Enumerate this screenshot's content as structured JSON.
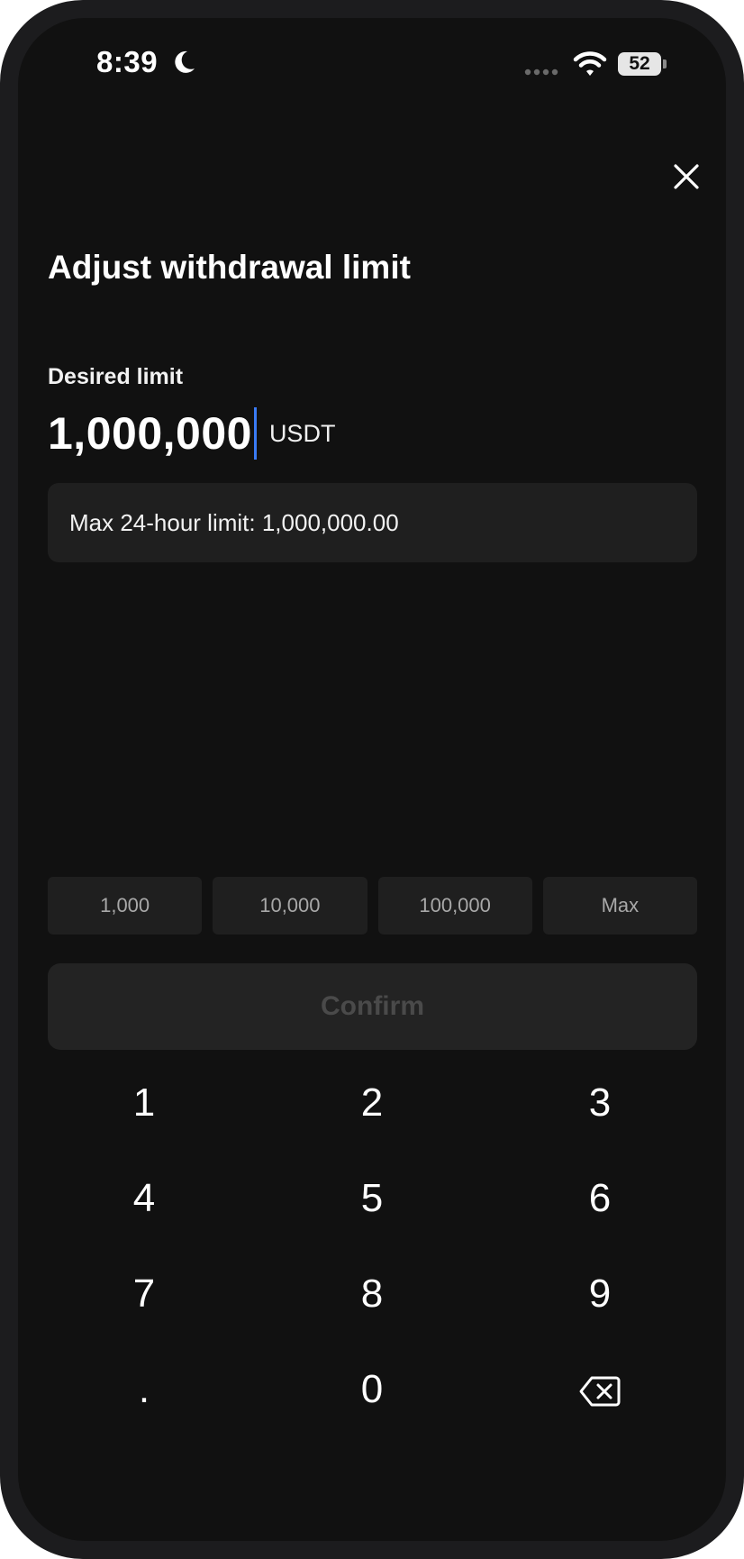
{
  "status_bar": {
    "time": "8:39",
    "battery_level": "52",
    "icons": [
      "moon-icon",
      "cellular-signal-icon",
      "wifi-icon",
      "battery-icon"
    ]
  },
  "header": {
    "close_icon": "close-icon",
    "title": "Adjust withdrawal limit"
  },
  "limit_field": {
    "label": "Desired limit",
    "value": "1,000,000",
    "unit": "USDT"
  },
  "info": {
    "text": "Max 24-hour limit: 1,000,000.00"
  },
  "presets": [
    {
      "label": "1,000"
    },
    {
      "label": "10,000"
    },
    {
      "label": "100,000"
    },
    {
      "label": "Max"
    }
  ],
  "confirm": {
    "label": "Confirm"
  },
  "keypad": {
    "keys": [
      "1",
      "2",
      "3",
      "4",
      "5",
      "6",
      "7",
      "8",
      "9",
      ".",
      "0"
    ],
    "backspace_icon": "backspace-icon"
  },
  "colors": {
    "background": "#111111",
    "surface": "#1f1f1f",
    "caret": "#3a7bf5",
    "disabled_text": "#4a4a4a"
  }
}
